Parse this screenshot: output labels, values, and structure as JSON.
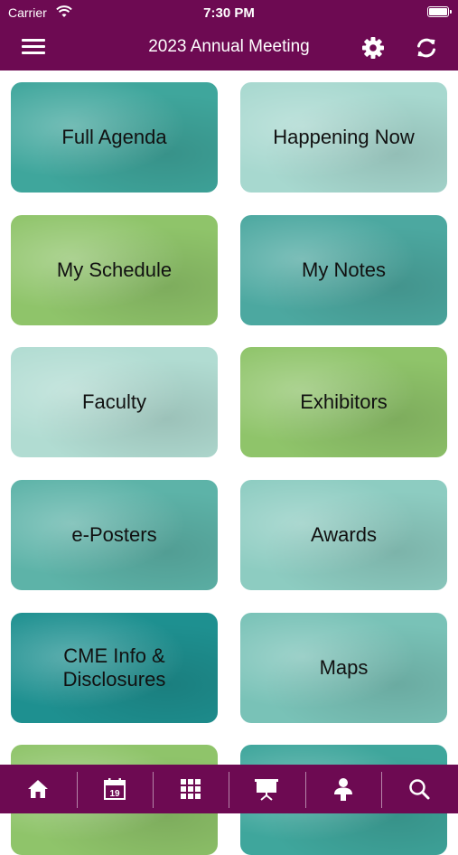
{
  "status_bar": {
    "carrier": "Carrier",
    "time": "7:30 PM"
  },
  "header": {
    "title": "2023 Annual Meeting"
  },
  "tiles": [
    {
      "label": "Full Agenda",
      "color": "#3fa69c"
    },
    {
      "label": "Happening Now",
      "color": "#a7d8cf"
    },
    {
      "label": "My Schedule",
      "color": "#8fc46a"
    },
    {
      "label": "My Notes",
      "color": "#4ca8a0"
    },
    {
      "label": "Faculty",
      "color": "#b1dcd2"
    },
    {
      "label": "Exhibitors",
      "color": "#8fc46a"
    },
    {
      "label": "e-Posters",
      "color": "#5db3a8"
    },
    {
      "label": "Awards",
      "color": "#8dccc1"
    },
    {
      "label": "CME Info & Disclosures",
      "color": "#1e9090"
    },
    {
      "label": "Maps",
      "color": "#79c2b7"
    },
    {
      "label": "",
      "color": "#8fc46a"
    },
    {
      "label": "",
      "color": "#3fa69c"
    }
  ],
  "tabbar": {
    "items": [
      {
        "icon": "home-icon"
      },
      {
        "icon": "calendar-icon",
        "day": "19"
      },
      {
        "icon": "grid-icon"
      },
      {
        "icon": "presentation-icon"
      },
      {
        "icon": "speaker-icon"
      },
      {
        "icon": "search-icon"
      }
    ]
  },
  "colors": {
    "brand": "#6d0a52"
  }
}
